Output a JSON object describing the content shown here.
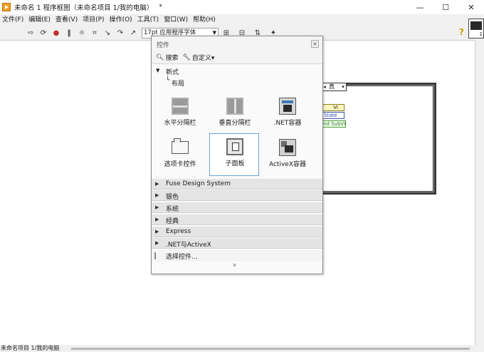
{
  "window": {
    "title": "未命名 1 程序框图（未命名项目 1/我的电脑）",
    "modified_marker": "*",
    "controls": {
      "minimize": "—",
      "maximize": "☐",
      "close": "✕"
    }
  },
  "menu": [
    "文件(F)",
    "编辑(E)",
    "查看(V)",
    "项目(P)",
    "操作(O)",
    "工具(T)",
    "窗口(W)",
    "帮助(H)"
  ],
  "toolbar": {
    "font_selector": "17pt 应用程序字体",
    "help": "?"
  },
  "vi_icon": {
    "number": "1"
  },
  "block_diagram": {
    "case_selector_value": "真",
    "nodes": {
      "vi": "VI",
      "state": "State",
      "subvi": "nd SubVI"
    }
  },
  "palette": {
    "title": "控件",
    "search_label": "搜索",
    "customize_label": "自定义▾",
    "open_category": "新式",
    "sub_category": "布局",
    "items": [
      {
        "label": "水平分隔栏",
        "icon": "horizontal-splitter-icon"
      },
      {
        "label": "垂直分隔栏",
        "icon": "vertical-splitter-icon"
      },
      {
        "label": ".NET容器",
        "icon": "net-container-icon"
      },
      {
        "label": "选项卡控件",
        "icon": "tab-control-icon"
      },
      {
        "label": "子面板",
        "icon": "subpanel-icon"
      },
      {
        "label": "ActiveX容器",
        "icon": "activex-container-icon"
      }
    ],
    "categories": [
      "Fuse Design System",
      "银色",
      "系统",
      "经典",
      "Express",
      ".NET与ActiveX"
    ],
    "more_label": "选择控件...",
    "expand_icon": "»"
  },
  "statusbar": {
    "text": "未命名项目 1/我的电脑"
  }
}
